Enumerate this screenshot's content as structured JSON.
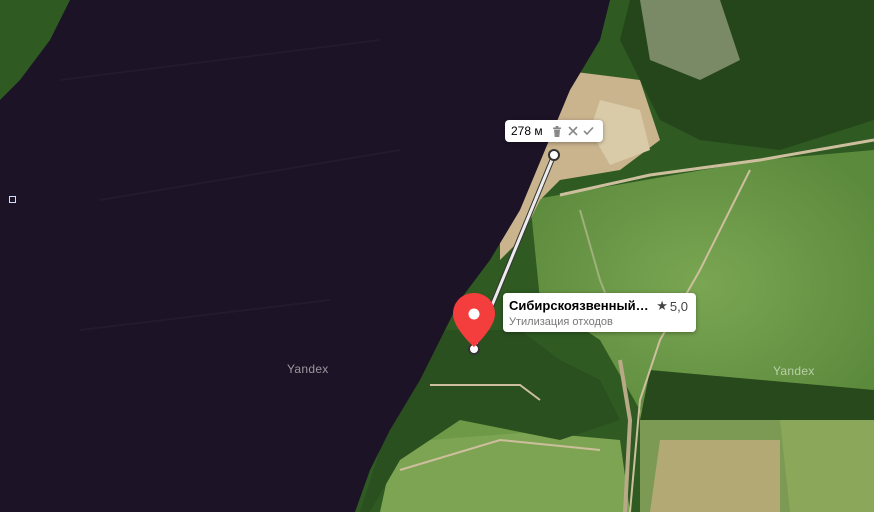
{
  "map": {
    "watermark": "Yandex",
    "ruler": {
      "distance_label": "278 м",
      "delete_icon": "trash-icon",
      "cancel_icon": "close-icon",
      "confirm_icon": "check-icon"
    },
    "place": {
      "name": "Сибирскоязвенный…",
      "rating": "5,0",
      "category": "Утилизация отходов",
      "pin_color": "#f43d3d"
    },
    "colors": {
      "river": "#1c1326",
      "forest": "#2f5a22",
      "field": "#6f9a4a",
      "sand": "#cbb996",
      "ruler_line": "#ffffff"
    }
  }
}
